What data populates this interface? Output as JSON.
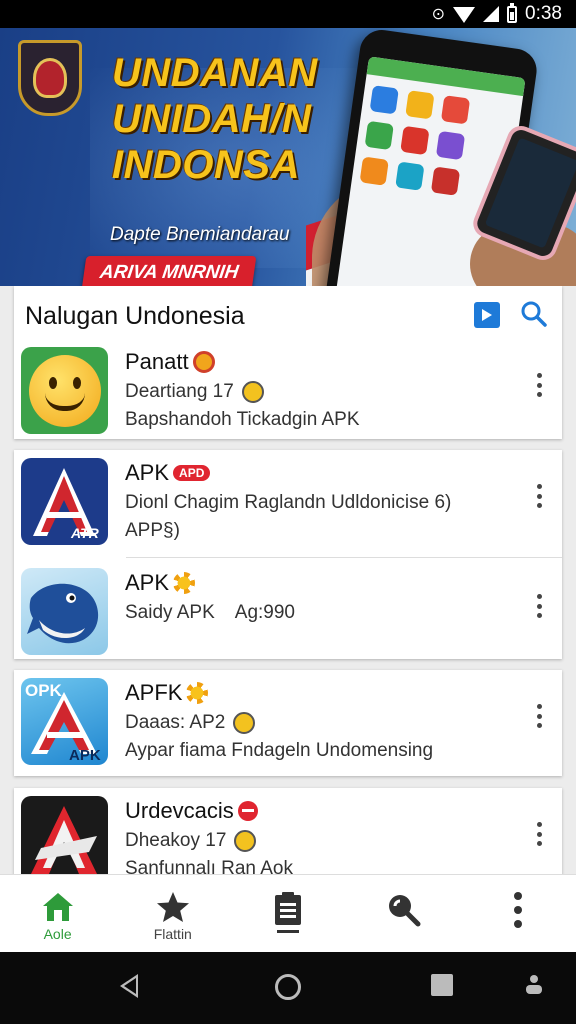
{
  "status_bar": {
    "time": "0:38"
  },
  "banner": {
    "title_lines": [
      "UNDANAN",
      "UNIDAH/N",
      "INDONSA"
    ],
    "subtitle": "Dapte Bnemiandarau",
    "cta": "ARIVA MNRNIH"
  },
  "section": {
    "title": "Nalugan Undonesia"
  },
  "apps": [
    {
      "name": "Panatt",
      "line2": "Deartiang 17",
      "line3": "Bapshandoh Tickadgin APK"
    },
    {
      "name": "APK",
      "badge": "APD",
      "line2": "Dionl Chagim Raglandn Udldonicise  6)",
      "line3": "APP§)"
    },
    {
      "name": "APK",
      "line2": "Saidy APK",
      "line2b": "Ag:990"
    },
    {
      "name": "APFK",
      "line2": "Daaas: AP2",
      "line3": "Aypar fiama  Fndageln Undomensing",
      "icon_text_top": "OPK",
      "icon_text_bottom": "APK"
    },
    {
      "name": "Urdevcacis",
      "line2": "Dheakoy 17",
      "line3": "Sanfunnalı    Ran Aok"
    }
  ],
  "app_icon_text": {
    "a_bottom": "ATR"
  },
  "bottom_nav": [
    {
      "label": "Aole",
      "icon": "home-icon"
    },
    {
      "label": "Flattin",
      "icon": "star-icon"
    },
    {
      "label": "",
      "icon": "clipboard-icon"
    },
    {
      "label": "",
      "icon": "search-icon"
    },
    {
      "label": "",
      "icon": "more-vert-icon"
    }
  ],
  "colors": {
    "accent_green": "#2e9b3a",
    "accent_blue": "#1e7ad8",
    "badge_red": "#e02530"
  }
}
